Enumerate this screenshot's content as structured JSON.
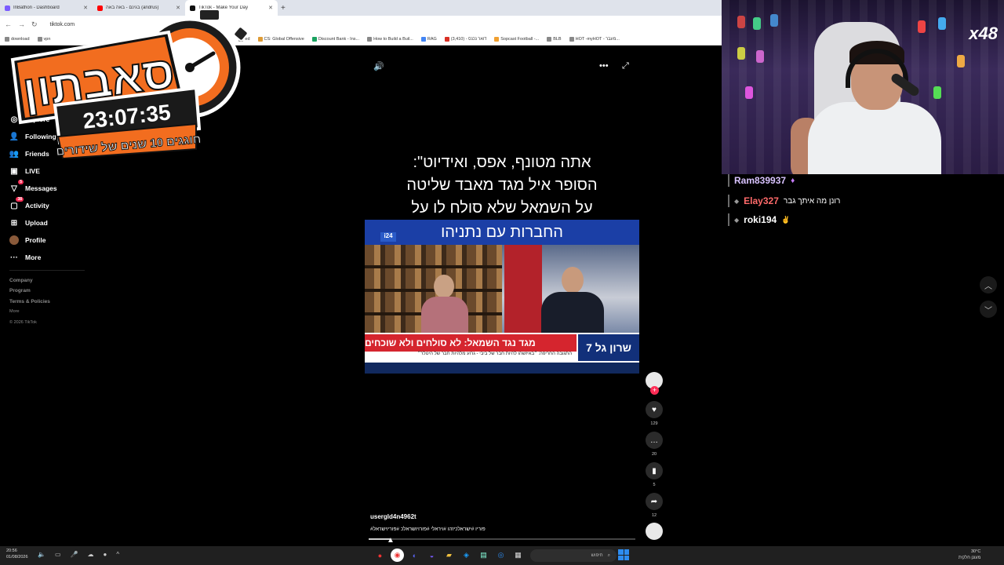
{
  "browser": {
    "tabs": [
      {
        "title": "InBathon - Dashboard",
        "color": "#7b5cff",
        "active": false
      },
      {
        "title": "בגינם - באה באה (andrus)",
        "color": "#ff0000",
        "active": false
      },
      {
        "title": "TikTok - Make Your Day",
        "color": "#111111",
        "active": true
      }
    ],
    "url": "tiktok.com",
    "bookmarks": [
      "download",
      "vpn",
      "ed",
      "CS: Global Offensive",
      "Discount Bank - Ins...",
      "How to Build a Buil...",
      "RAG",
      "(3,410) - דואר נכנס",
      "Sopcast Football -...",
      "BLB",
      "HOT -myHOT - מעבר..."
    ]
  },
  "overlay": {
    "title": "סאבתון",
    "timer": "23:07:35",
    "subtitle": "חוגגים 10 שנים של שידורים"
  },
  "sidebar": {
    "items": [
      {
        "label": "Explore",
        "icon": "compass-icon"
      },
      {
        "label": "Following",
        "icon": "following-icon"
      },
      {
        "label": "Friends",
        "icon": "friends-icon"
      },
      {
        "label": "LIVE",
        "icon": "live-icon"
      },
      {
        "label": "Messages",
        "icon": "messages-icon",
        "badge": "5"
      },
      {
        "label": "Activity",
        "icon": "activity-icon",
        "badge": "38"
      },
      {
        "label": "Upload",
        "icon": "upload-icon"
      },
      {
        "label": "Profile",
        "icon": "profile-icon"
      },
      {
        "label": "More",
        "icon": "more-icon"
      }
    ],
    "footer": {
      "company": "Company",
      "program": "Program",
      "terms": "Terms & Policies",
      "more": "More",
      "copyright": "© 2026 TikTok"
    }
  },
  "video": {
    "caption_lines": [
      "אתה מטונף, אפס, ואידיוט\":",
      "הסופר איל מגד מאבד שליטה",
      "על השמאל שלא סולח לו על",
      "החברות עם נתניהו"
    ],
    "channel_logo": "i24",
    "chyron_main": "מגד נגד השמאל: לא סולחים ולא שוכחים",
    "chyron_sub": "התגובה החריפה: ״באיזשהו להיות חבר של ביבי - גרוע מלהיות חבר של היטלר״",
    "program_tag": "שרון גל 7",
    "username": "usergld4n4962t",
    "hashtags": "#פוריו #ישראלכיזהו #ויראלי #פורויושראלכ #פוריוישראל",
    "progress": 0.08,
    "actions": {
      "likes": "129",
      "comments": "20",
      "saves": "5",
      "shares": "12"
    }
  },
  "webcam": {
    "badge": "x48"
  },
  "chat": {
    "messages": [
      {
        "user": "Ram839937",
        "color": "#d9c3ff",
        "text": ""
      },
      {
        "user": "Elay327",
        "color": "#ff6a6a",
        "text": "רונן מה איתך גבר"
      },
      {
        "user": "roki194",
        "color": "#ffffff",
        "text": ""
      }
    ]
  },
  "taskbar": {
    "time": "20:56",
    "date": "01/08/2026",
    "search_placeholder": "חיפוש",
    "weather_temp": "30°C",
    "weather_desc": "מעונן חלקית"
  }
}
